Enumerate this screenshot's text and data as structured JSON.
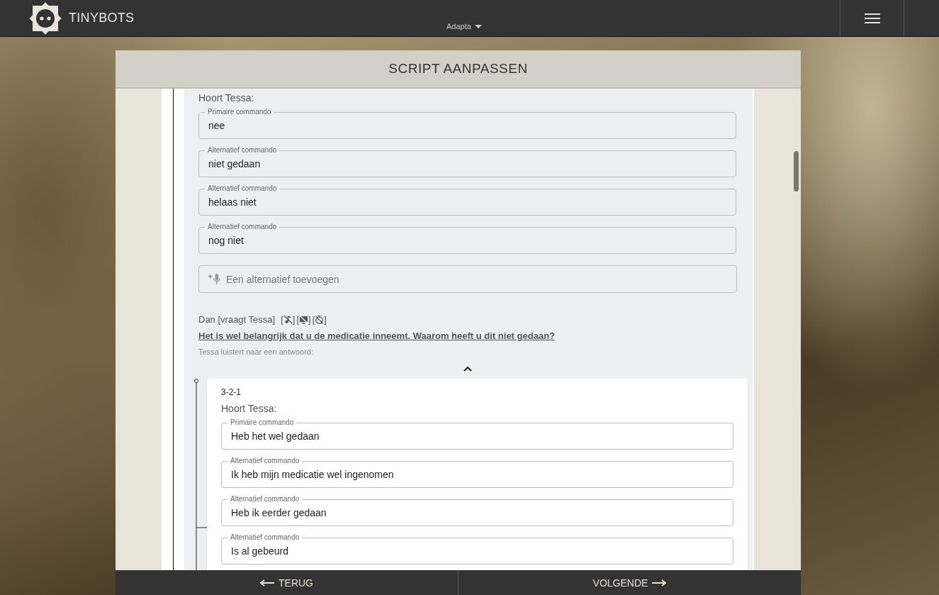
{
  "app": {
    "brand": "TINYBOTS",
    "account": "Adapta"
  },
  "dialog": {
    "title": "SCRIPT AANPASSEN"
  },
  "step": {
    "hears_label": "Hoort Tessa:",
    "commands": [
      {
        "label": "Primaire commando",
        "value": "nee"
      },
      {
        "label": "Alternatief commando",
        "value": "niet gedaan"
      },
      {
        "label": "Alternatief commando",
        "value": "helaas niet"
      },
      {
        "label": "Alternatief commando",
        "value": "nog niet"
      }
    ],
    "add_placeholder": "Een alternatief toevoegen",
    "then_label": "Dan [vraagt Tessa]",
    "flags": [
      {
        "kind": "music-off",
        "open": "[",
        "close": "]"
      },
      {
        "kind": "screen-off",
        "open": "[",
        "close": "]"
      },
      {
        "kind": "timer-off",
        "open": "[",
        "close": "]"
      }
    ],
    "question": "Het is wel belangrijk dat u de medicatie inneemt. Waarom heeft u dit niet gedaan?",
    "listen_label": "Tessa luistert naar een antwoord:",
    "expanded": true,
    "branches": [
      {
        "id": "3-2-1",
        "hears_label": "Hoort Tessa:",
        "commands": [
          {
            "label": "Primaire commando",
            "value": "Heb het wel gedaan"
          },
          {
            "label": "Alternatief commando",
            "value": "Ik heb mijn medicatie wel ingenomen"
          },
          {
            "label": "Alternatief commando",
            "value": "Heb ik eerder gedaan"
          },
          {
            "label": "Alternatief commando",
            "value": "Is al gebeurd"
          }
        ]
      }
    ]
  },
  "footer": {
    "back": "TERUG",
    "next": "VOLGENDE"
  }
}
